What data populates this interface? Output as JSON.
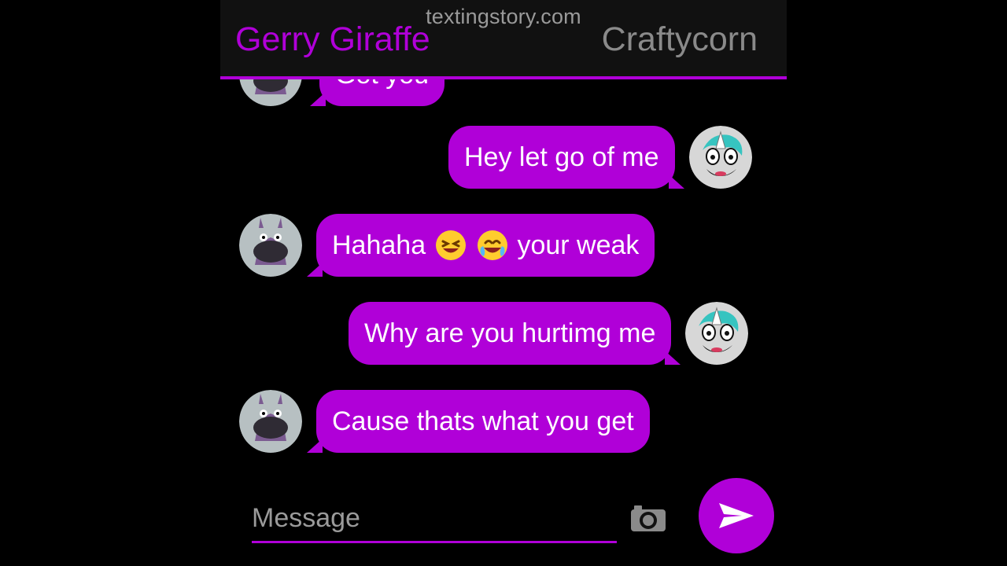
{
  "header": {
    "watermark": "textingstory.com",
    "left_contact": "Gerry Giraffe",
    "right_contact": "Craftycorn"
  },
  "messages": [
    {
      "side": "left",
      "text_prefix": "Got you",
      "avatar": "giraffe-avatar"
    },
    {
      "side": "right",
      "text_prefix": "Hey let go of me",
      "avatar": "unicorn-avatar"
    },
    {
      "side": "left",
      "text_prefix": "Hahaha",
      "emoji_1": "laughing-face-emoji",
      "emoji_2": "face-with-tears-of-joy-emoji",
      "text_suffix": "your weak",
      "avatar": "giraffe-avatar"
    },
    {
      "side": "right",
      "text_prefix": "Why are you hurtimg me",
      "avatar": "unicorn-avatar"
    },
    {
      "side": "left",
      "text_prefix": "Cause thats what you get",
      "avatar": "giraffe-avatar"
    }
  ],
  "composer": {
    "placeholder": "Message",
    "camera_icon": "camera-icon",
    "send_icon": "send-icon"
  },
  "colors": {
    "accent": "#b000d8",
    "background": "#000000",
    "header_background": "#111111",
    "muted_text": "#8a8a8a"
  }
}
